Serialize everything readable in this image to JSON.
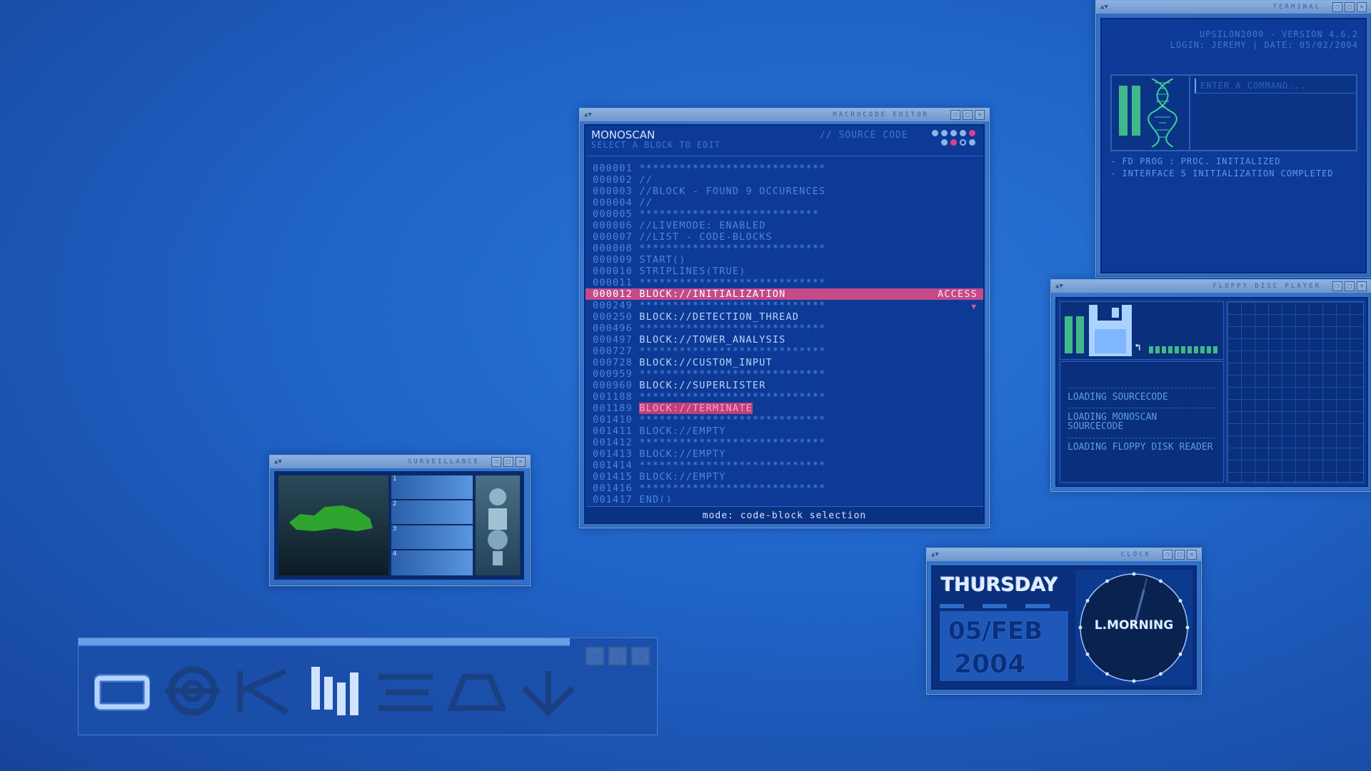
{
  "terminal": {
    "title": "TERMINAL",
    "version_line": "UPSILON2000 - VERSION 4.6.2",
    "login_line": "LOGIN: JEREMY | DATE: 05/02/2004",
    "input_placeholder": "ENTER A COMMAND...",
    "log": [
      "- FD PROG : PROC. INITIALIZED",
      "- INTERFACE S INITIALIZATION COMPLETED"
    ]
  },
  "editor": {
    "title": "MACROCODE EDITOR",
    "app_name": "MONOSCAN",
    "subtitle": "SELECT A BLOCK TO EDIT",
    "source_label": "// SOURCE CODE",
    "access_label": "ACCESS",
    "status": "mode: code-block selection",
    "lines": [
      {
        "num": "000001",
        "text": "****************************",
        "kind": "star"
      },
      {
        "num": "000002",
        "text": "//",
        "kind": "comment"
      },
      {
        "num": "000003",
        "text": "//BLOCK - FOUND 9 OCCURENCES",
        "kind": "comment"
      },
      {
        "num": "000004",
        "text": "//",
        "kind": "comment"
      },
      {
        "num": "000005",
        "text": "***************************",
        "kind": "star"
      },
      {
        "num": "000006",
        "text": "//LIVEMODE: ENABLED",
        "kind": "comment"
      },
      {
        "num": "000007",
        "text": "//LIST - CODE-BLOCKS",
        "kind": "comment"
      },
      {
        "num": "000008",
        "text": "****************************",
        "kind": "star"
      },
      {
        "num": "000009",
        "text": "START()",
        "kind": "comment"
      },
      {
        "num": "000010",
        "text": "STRIPLINES(TRUE)",
        "kind": "comment"
      },
      {
        "num": "000011",
        "text": "****************************",
        "kind": "star"
      },
      {
        "num": "000012",
        "text": "BLOCK://INITIALIZATION",
        "kind": "selected"
      },
      {
        "num": "000249",
        "text": "****************************",
        "kind": "star"
      },
      {
        "num": "000250",
        "text": "BLOCK://DETECTION_THREAD",
        "kind": "block"
      },
      {
        "num": "000496",
        "text": "****************************",
        "kind": "star"
      },
      {
        "num": "000497",
        "text": "BLOCK://TOWER_ANALYSIS",
        "kind": "block"
      },
      {
        "num": "000727",
        "text": "****************************",
        "kind": "star"
      },
      {
        "num": "000728",
        "text": "BLOCK://CUSTOM_INPUT",
        "kind": "block"
      },
      {
        "num": "000959",
        "text": "****************************",
        "kind": "star"
      },
      {
        "num": "000960",
        "text": "BLOCK://SUPERLISTER",
        "kind": "block"
      },
      {
        "num": "001188",
        "text": "****************************",
        "kind": "star"
      },
      {
        "num": "001189",
        "text": "BLOCK://TERMINATE",
        "kind": "terminate"
      },
      {
        "num": "001410",
        "text": "****************************",
        "kind": "star"
      },
      {
        "num": "001411",
        "text": "BLOCK://EMPTY",
        "kind": "comment"
      },
      {
        "num": "001412",
        "text": "****************************",
        "kind": "star"
      },
      {
        "num": "001413",
        "text": "BLOCK://EMPTY",
        "kind": "comment"
      },
      {
        "num": "001414",
        "text": "****************************",
        "kind": "star"
      },
      {
        "num": "001415",
        "text": "BLOCK://EMPTY",
        "kind": "comment"
      },
      {
        "num": "001416",
        "text": "****************************",
        "kind": "star"
      },
      {
        "num": "001417",
        "text": "END()",
        "kind": "comment"
      }
    ]
  },
  "floppy": {
    "title": "FLOPPY DISC PLAYER",
    "log": [
      "LOADING SOURCECODE",
      "LOADING MONOSCAN SOURCECODE",
      "LOADING FLOPPY DISK READER"
    ]
  },
  "surveillance": {
    "title": "SURVEILLANCE",
    "cameras": [
      "1",
      "2",
      "3",
      "4"
    ]
  },
  "clock": {
    "title": "CLOCK",
    "day": "THURSDAY",
    "date": "05/FEB",
    "year": "2004",
    "period": "L.MORNING"
  },
  "toolbar": {
    "icons": [
      "window-icon",
      "target-icon",
      "k-icon",
      "bars-icon",
      "list-icon",
      "trapezoid-icon",
      "down-arrow-icon"
    ]
  }
}
